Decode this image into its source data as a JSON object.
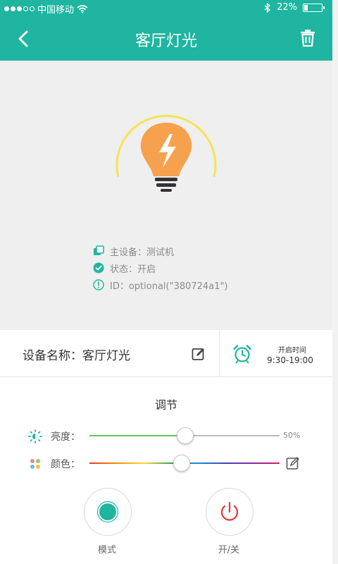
{
  "status_bar": {
    "carrier": "中国移动",
    "battery_text": "22%",
    "battery_level": 0.22,
    "signal_bars_filled": 3,
    "signal_bars_total": 5
  },
  "header": {
    "title": "客厅灯光",
    "back_icon": "back-arrow-icon",
    "delete_icon": "trash-icon"
  },
  "device_info": {
    "main_device": "主设备：测试机",
    "status": "状态：开启",
    "id": "ID：optional(\"380724a1\")"
  },
  "device_row": {
    "name_label": "设备名称：",
    "name_value": "客厅灯光",
    "timer_label": "开启时间",
    "timer_value": "9:30-19:00"
  },
  "adjust": {
    "title": "调节",
    "brightness_label": "亮度：",
    "brightness_value": 0.5,
    "brightness_text": "50%",
    "color_label": "颜色：",
    "color_position": 0.48
  },
  "buttons": {
    "mode_label": "模式",
    "power_label": "开/关"
  },
  "colors": {
    "primary": "#1fb5a0",
    "bulb": "#f6a14d",
    "arc": "#f5e451",
    "power": "#e53935",
    "background": "#efefef"
  }
}
